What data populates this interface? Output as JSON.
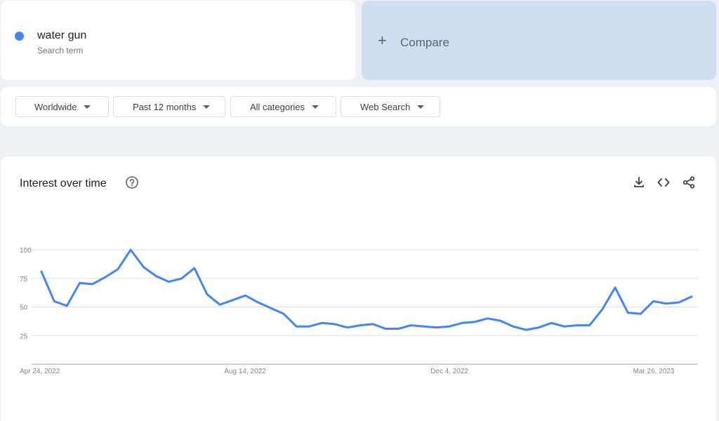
{
  "search_term": {
    "name": "water gun",
    "sublabel": "Search term",
    "color": "#4285f4"
  },
  "compare": {
    "icon": "plus-icon",
    "label": "Compare"
  },
  "filters": [
    {
      "label": "Worldwide"
    },
    {
      "label": "Past 12 months"
    },
    {
      "label": "All categories"
    },
    {
      "label": "Web Search"
    }
  ],
  "chart_panel": {
    "title": "Interest over time",
    "icons": [
      "help-icon",
      "download-icon",
      "embed-code-icon",
      "share-icon"
    ]
  },
  "chart_data": {
    "type": "line",
    "x_tick_labels": [
      "Apr 24, 2022",
      "Aug 14, 2022",
      "Dec 4, 2022",
      "Mar 26, 2023"
    ],
    "yticks": [
      100,
      75,
      50,
      25
    ],
    "ylim": [
      0,
      100
    ],
    "grid": true,
    "series": [
      {
        "color": "#4285f4",
        "values": [
          81,
          55,
          51,
          71,
          70,
          76,
          83,
          100,
          85,
          77,
          72,
          75,
          84,
          61,
          52,
          56,
          60,
          54,
          49,
          44,
          33,
          33,
          36,
          35,
          32,
          34,
          35,
          31,
          31,
          34,
          33,
          32,
          33,
          36,
          37,
          40,
          38,
          33,
          30,
          32,
          36,
          33,
          34,
          34,
          48,
          67,
          45,
          44,
          55,
          53,
          54,
          59
        ]
      }
    ]
  }
}
